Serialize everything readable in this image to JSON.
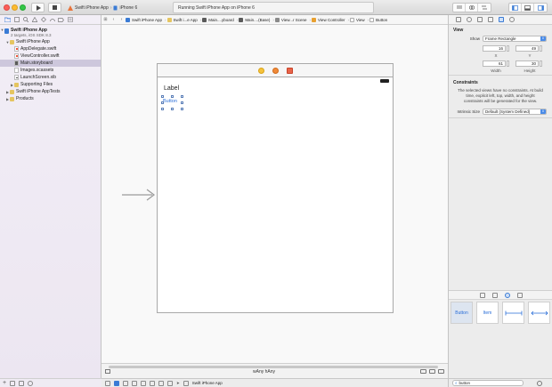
{
  "toolbar": {
    "scheme_target": "Swift iPhone App",
    "device": "iPhone 6",
    "activity_text": "Running Swift iPhone App on iPhone 6"
  },
  "navigator": {
    "project": {
      "name": "Swift iPhone App",
      "subtitle": "2 targets, iOS SDK 8.3"
    },
    "items": [
      {
        "label": "Swift iPhone App",
        "depth": 1,
        "type": "folder",
        "expanded": true
      },
      {
        "label": "AppDelegate.swift",
        "depth": 2,
        "type": "swift"
      },
      {
        "label": "ViewController.swift",
        "depth": 2,
        "type": "swift"
      },
      {
        "label": "Main.storyboard",
        "depth": 2,
        "type": "storyboard",
        "selected": true
      },
      {
        "label": "Images.xcassets",
        "depth": 2,
        "type": "assets"
      },
      {
        "label": "LaunchScreen.xib",
        "depth": 2,
        "type": "xib"
      },
      {
        "label": "Supporting Files",
        "depth": 2,
        "type": "folder",
        "expanded": false
      },
      {
        "label": "Swift iPhone AppTests",
        "depth": 1,
        "type": "folder",
        "expanded": false
      },
      {
        "label": "Products",
        "depth": 1,
        "type": "folder",
        "expanded": false
      }
    ]
  },
  "jumpbar": {
    "crumbs": [
      {
        "label": "Swift iPhone App",
        "color": "#3a7bd5"
      },
      {
        "label": "Swift i...e App",
        "color": "#e5c560"
      },
      {
        "label": "Main....yboard",
        "color": "#5a5a5a"
      },
      {
        "label": "Main....(Base)",
        "color": "#5a5a5a"
      },
      {
        "label": "View...r Scene",
        "color": "#8a8a8a"
      },
      {
        "label": "View Controller",
        "color": "#e8a030"
      },
      {
        "label": "View",
        "color": "#c0c0c0"
      },
      {
        "label": "Button",
        "color": "#c0c0c0"
      }
    ]
  },
  "canvas": {
    "label_text": "Label",
    "button_text": "Button",
    "size_class": "wAny hAny"
  },
  "debug": {
    "process": "Swift iPhone App"
  },
  "inspector": {
    "view_section": "View",
    "show_label": "Show",
    "show_value": "Frame Rectangle",
    "x": "16",
    "y": "49",
    "x_caption": "X",
    "y_caption": "Y",
    "width": "61",
    "height": "30",
    "width_caption": "Width",
    "height_caption": "Height",
    "constraints_title": "Constraints",
    "constraints_text": "The selected views have no constraints. At build time, explicit left, top, width, and height constraints will be generated for the view.",
    "intrinsic_label": "Intrinsic Size",
    "intrinsic_value": "Default (System Defined)"
  },
  "library": {
    "items": [
      "Button",
      "Item"
    ],
    "filter": "button"
  }
}
